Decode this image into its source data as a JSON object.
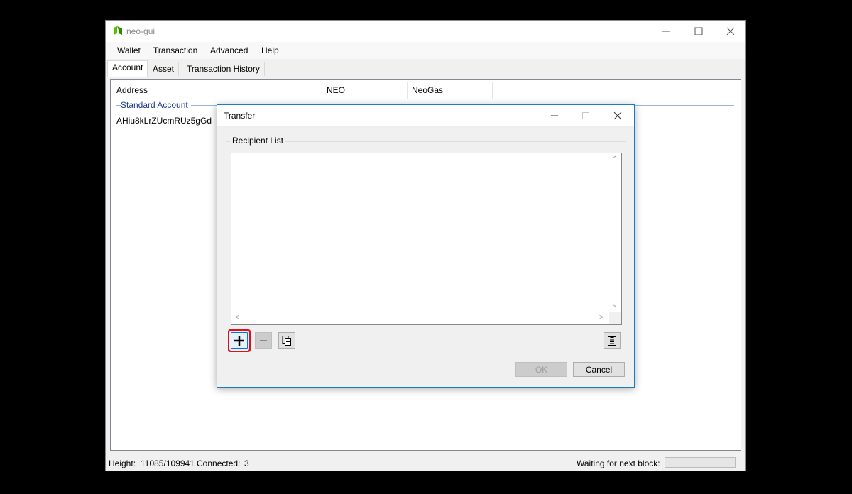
{
  "window": {
    "title": "neo-gui"
  },
  "menu": {
    "items": [
      "Wallet",
      "Transaction",
      "Advanced",
      "Help"
    ]
  },
  "tabs": [
    "Account",
    "Asset",
    "Transaction History"
  ],
  "accounts_table": {
    "columns": [
      "Address",
      "NEO",
      "NeoGas"
    ],
    "group_label": "Standard Account",
    "rows": [
      {
        "address": "AHiu8kLrZUcmRUz5gGd"
      }
    ]
  },
  "status": {
    "height_label": "Height:",
    "height_value": "11085/109941",
    "connected_label": "Connected:",
    "connected_value": "3",
    "waiting_label": "Waiting for next block:"
  },
  "dialog": {
    "title": "Transfer",
    "recipient_list_label": "Recipient List",
    "ok_label": "OK",
    "cancel_label": "Cancel"
  },
  "colors": {
    "accent": "#0078d7",
    "highlight_ring": "#e0101a",
    "group_label": "#1e3d8c",
    "neo_green": "#58bf00"
  },
  "icons": [
    "neo-logo-icon",
    "add-icon",
    "remove-icon",
    "duplicate-icon",
    "paste-icon"
  ]
}
